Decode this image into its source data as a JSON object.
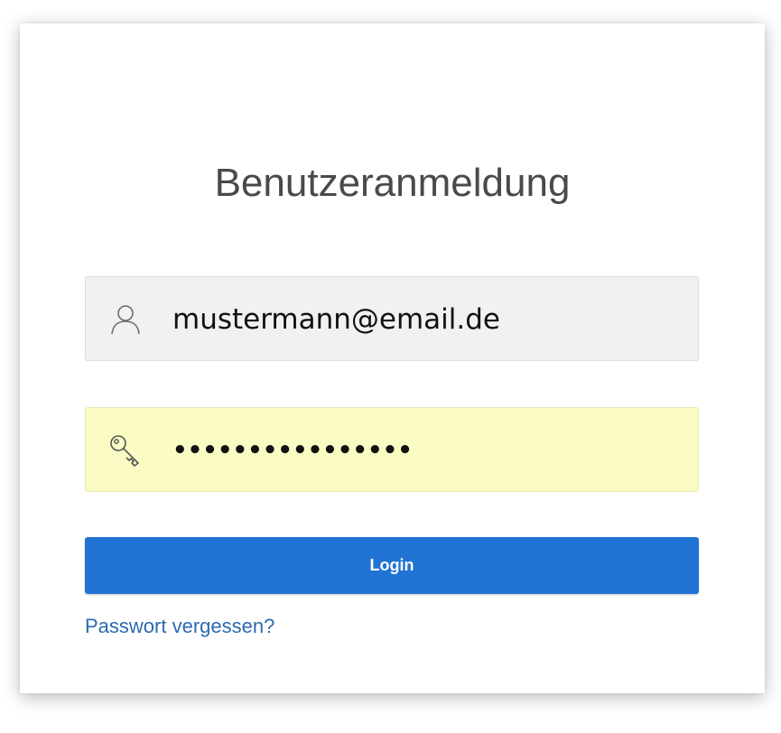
{
  "login_form": {
    "title": "Benutzeranmeldung",
    "username": {
      "value": "mustermann@email.de",
      "icon": "user-icon"
    },
    "password": {
      "value": "••••••••••••••••",
      "icon": "key-icon"
    },
    "login_button_label": "Login",
    "forgot_password_link": "Passwort vergessen?"
  },
  "colors": {
    "button_background": "#2173d3",
    "link": "#2c6ab0",
    "password_field_autofill": "#fafcc3",
    "username_field": "#f1f1f1"
  }
}
